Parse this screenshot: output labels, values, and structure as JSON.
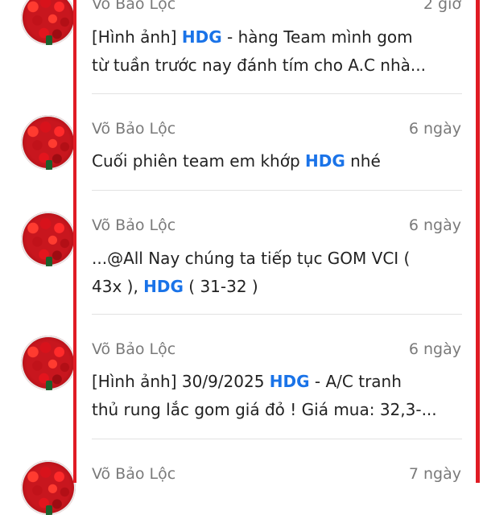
{
  "messages": [
    {
      "author": "Võ Bảo Lộc",
      "time": "2 giờ",
      "lines": [
        {
          "before": "[Hình ảnh] ",
          "highlight": "HDG",
          "after": " - hàng Team mình gom"
        },
        {
          "before": "từ tuần trước nay đánh tím cho A.C nhà...",
          "highlight": "",
          "after": ""
        }
      ]
    },
    {
      "author": "Võ Bảo Lộc",
      "time": "6 ngày",
      "lines": [
        {
          "before": "Cuối phiên team em khớp ",
          "highlight": "HDG",
          "after": " nhé"
        }
      ]
    },
    {
      "author": "Võ Bảo Lộc",
      "time": "6 ngày",
      "lines": [
        {
          "before": "...@All Nay chúng ta tiếp tục GOM VCI (",
          "highlight": "",
          "after": ""
        },
        {
          "before": "43x ), ",
          "highlight": "HDG",
          "after": " ( 31-32 )"
        }
      ]
    },
    {
      "author": "Võ Bảo Lộc",
      "time": "6 ngày",
      "lines": [
        {
          "before": "[Hình ảnh] 30/9/2025 ",
          "highlight": "HDG",
          "after": " - A/C tranh"
        },
        {
          "before": "thủ rung lắc gom giá đỏ ! Giá mua: 32,3-...",
          "highlight": "",
          "after": ""
        }
      ]
    },
    {
      "author": "Võ Bảo Lộc",
      "time": "7 ngày",
      "lines": []
    }
  ],
  "colors": {
    "highlight": "#1a73e8",
    "frame": "#e01b24",
    "meta": "#7a7a7a"
  }
}
